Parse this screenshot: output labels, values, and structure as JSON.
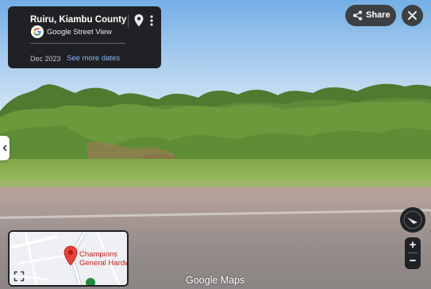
{
  "info_card": {
    "location_title": "Ruiru, Kiambu County",
    "brand": "Google Street View",
    "capture_date": "Dec 2023",
    "see_more_link": "See more dates",
    "icons": [
      "map-pin-icon",
      "more-vert-icon",
      "google-g-icon"
    ]
  },
  "top_buttons": {
    "share_label": "Share",
    "share_icon": "share-icon",
    "close_icon": "close-icon"
  },
  "side_tab": {
    "icon": "chevron-left-icon"
  },
  "navigation": {
    "compass_icon": "compass-icon",
    "zoom_in_label": "+",
    "zoom_out_label": "−"
  },
  "minimap": {
    "place_line1": "Champions",
    "place_line2": "General Hardw",
    "pin_icon": "place-pin-icon",
    "expand_icon": "expand-icon",
    "pin_color": "#ea4335",
    "place_label_color": "#c5221f"
  },
  "watermark": "Google Maps",
  "colors": {
    "panel_bg": "#202124",
    "link": "#8ab4f8",
    "button_bg": "#3c4043"
  }
}
